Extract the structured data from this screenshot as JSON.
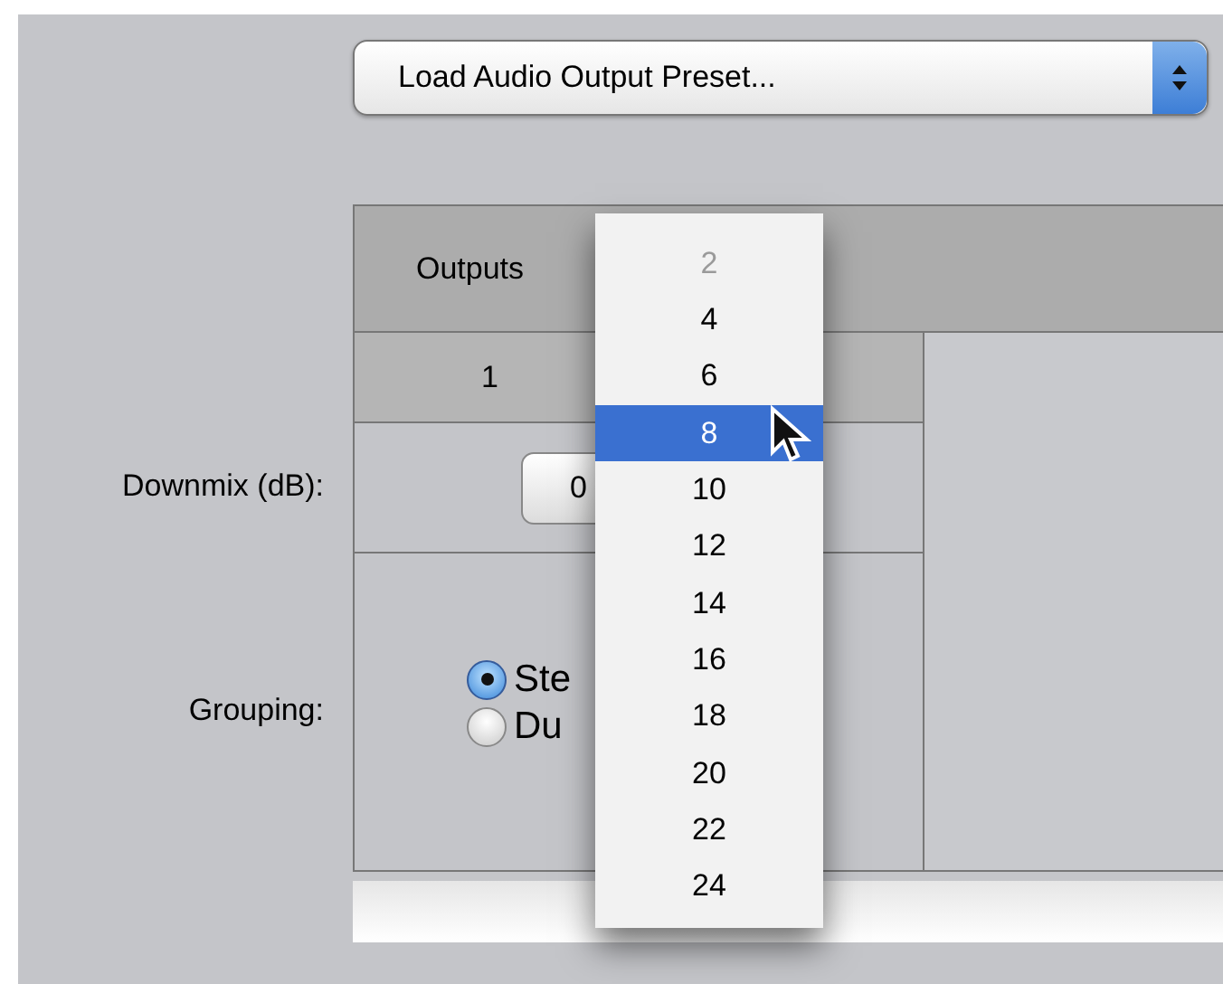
{
  "preset_popup": {
    "label": "Load Audio Output Preset..."
  },
  "table": {
    "header": "Outputs",
    "column_1": "1",
    "rows": [
      {
        "label": "Downmix (dB):",
        "kind": "stepper",
        "value": "0"
      },
      {
        "label": "Grouping:",
        "kind": "radios",
        "options": [
          {
            "label": "Ste",
            "selected": true
          },
          {
            "label": "Du",
            "selected": false
          }
        ]
      }
    ]
  },
  "outputs_menu": [
    {
      "label": "2",
      "disabled": true,
      "selected": false
    },
    {
      "label": "4",
      "disabled": false,
      "selected": false
    },
    {
      "label": "6",
      "disabled": false,
      "selected": false
    },
    {
      "label": "8",
      "disabled": false,
      "selected": true
    },
    {
      "label": "10",
      "disabled": false,
      "selected": false
    },
    {
      "label": "12",
      "disabled": false,
      "selected": false
    },
    {
      "label": "14",
      "disabled": false,
      "selected": false
    },
    {
      "label": "16",
      "disabled": false,
      "selected": false
    },
    {
      "label": "18",
      "disabled": false,
      "selected": false
    },
    {
      "label": "20",
      "disabled": false,
      "selected": false
    },
    {
      "label": "22",
      "disabled": false,
      "selected": false
    },
    {
      "label": "24",
      "disabled": false,
      "selected": false
    }
  ]
}
